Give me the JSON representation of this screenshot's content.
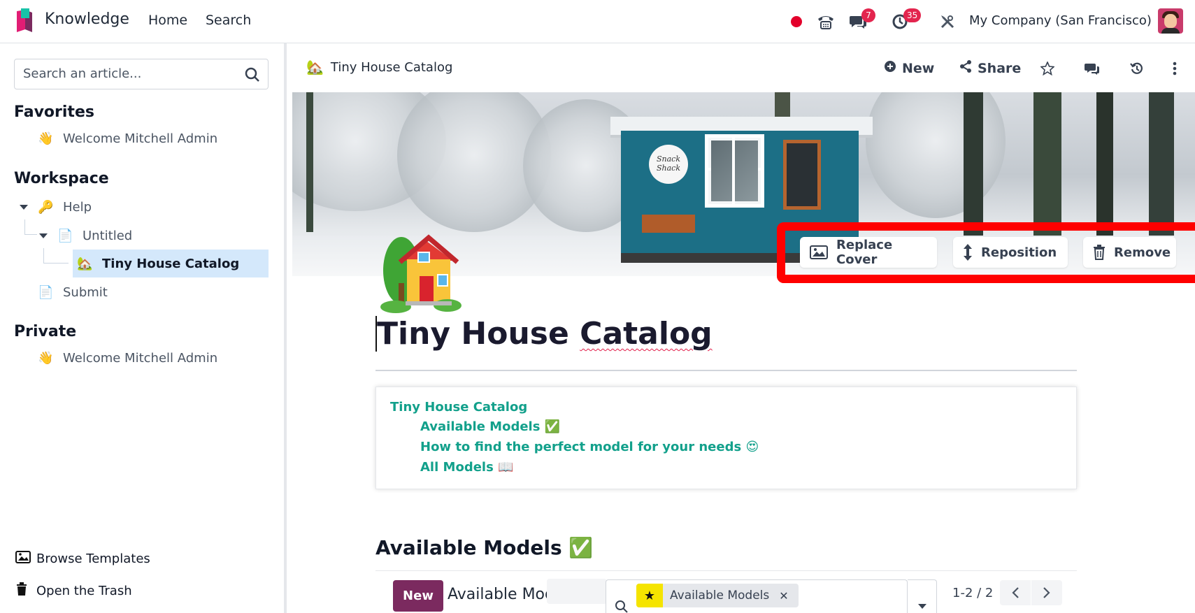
{
  "navbar": {
    "app_name": "Knowledge",
    "menu": [
      {
        "label": "Home"
      },
      {
        "label": "Search"
      }
    ],
    "message_count": "7",
    "activity_count": "35",
    "company": "My Company (San Francisco)"
  },
  "sidebar": {
    "search_placeholder": "Search an article...",
    "favorites_title": "Favorites",
    "favorites": [
      {
        "emoji": "👋",
        "label": "Welcome Mitchell Admin"
      }
    ],
    "workspace_title": "Workspace",
    "workspace": [
      {
        "emoji": "🔑",
        "label": "Help"
      },
      {
        "emoji": "📄",
        "label": "Untitled"
      },
      {
        "emoji": "🏡",
        "label": "Tiny House Catalog"
      },
      {
        "emoji": "📄",
        "label": "Submit"
      }
    ],
    "private_title": "Private",
    "private": [
      {
        "emoji": "👋",
        "label": "Welcome Mitchell Admin"
      }
    ],
    "browse_templates": "Browse Templates",
    "open_trash": "Open the Trash"
  },
  "header": {
    "breadcrumb_emoji": "🏡",
    "breadcrumb": "Tiny House Catalog",
    "new_label": "New",
    "share_label": "Share"
  },
  "cover": {
    "replace_label": "Replace Cover",
    "reposition_label": "Reposition",
    "remove_label": "Remove",
    "sign_text": "Snack Shack"
  },
  "article": {
    "icon": "🏡",
    "title_part1": "Tiny House ",
    "title_part2": "Catalog",
    "toc": [
      {
        "label": "Tiny House Catalog",
        "level": 1
      },
      {
        "label": "Available Models ✅",
        "level": 2
      },
      {
        "label": "How to find the perfect model for your needs 😍",
        "level": 2
      },
      {
        "label": "All Models 📖",
        "level": 2
      }
    ],
    "section_title": "Available Models ✅"
  },
  "embed": {
    "new_label": "New",
    "title": "Available Models",
    "facet_label": "Available Models",
    "pager": "1-2 / 2"
  },
  "colors": {
    "brand": "#7b2a5f",
    "toc_link": "#12a08b",
    "highlight_border": "#ff0000",
    "active_item_bg": "#d4e8fb",
    "badge": "#e3254e"
  }
}
